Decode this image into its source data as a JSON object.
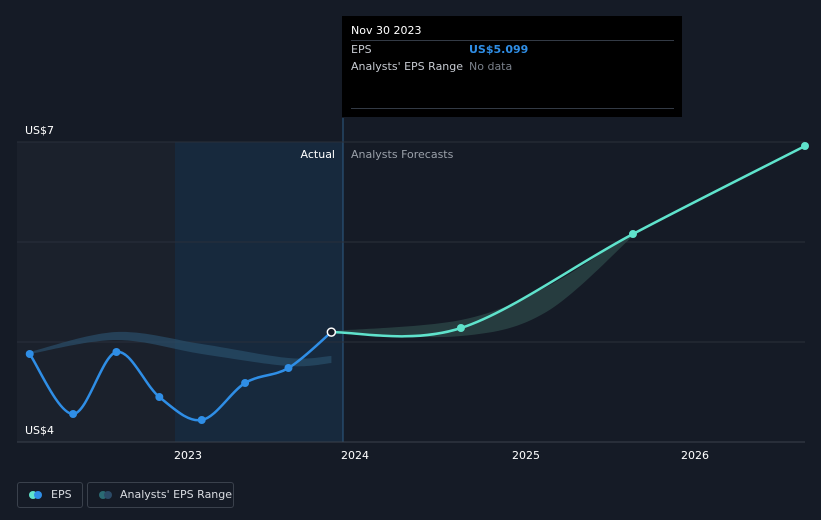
{
  "tooltip": {
    "date": "Nov 30 2023",
    "eps_label": "EPS",
    "eps_value": "US$5.099",
    "range_label": "Analysts' EPS Range",
    "range_value": "No data"
  },
  "labels": {
    "actual": "Actual",
    "forecast": "Analysts Forecasts"
  },
  "legend": {
    "eps": "EPS",
    "range": "Analysts' EPS Range"
  },
  "colors": {
    "eps_actual": "#2f8ee6",
    "eps_forecast": "#5fe3cc",
    "range_band": "#2a4f6a",
    "background": "#151b26"
  },
  "chart_data": {
    "type": "line",
    "ylim": [
      4,
      7
    ],
    "y_tick_labels": [
      "US$7",
      "US$4"
    ],
    "x_ticks": [
      "2023",
      "2024",
      "2025",
      "2026"
    ],
    "x_range": [
      "2022-02-01",
      "2026-08-31"
    ],
    "series": [
      {
        "name": "EPS",
        "values": [
          {
            "x": "2022-02-28",
            "y": 4.88
          },
          {
            "x": "2022-05-31",
            "y": 4.28
          },
          {
            "x": "2022-08-31",
            "y": 4.9
          },
          {
            "x": "2022-11-30",
            "y": 4.45
          },
          {
            "x": "2023-02-28",
            "y": 4.22
          },
          {
            "x": "2023-05-31",
            "y": 4.59
          },
          {
            "x": "2023-08-31",
            "y": 4.74
          },
          {
            "x": "2023-11-30",
            "y": 5.099
          }
        ]
      },
      {
        "name": "EPS Forecast",
        "values": [
          {
            "x": "2023-11-30",
            "y": 5.099
          },
          {
            "x": "2024-08-31",
            "y": 5.14
          },
          {
            "x": "2025-08-31",
            "y": 6.08
          },
          {
            "x": "2026-08-31",
            "y": 6.96
          }
        ]
      },
      {
        "name": "Analysts' EPS Range (historical band)",
        "upper": [
          {
            "x": "2022-02-28",
            "y": 4.9
          },
          {
            "x": "2022-08-31",
            "y": 5.1
          },
          {
            "x": "2023-02-28",
            "y": 4.98
          },
          {
            "x": "2023-08-31",
            "y": 4.84
          },
          {
            "x": "2023-11-30",
            "y": 4.86
          }
        ],
        "lower": [
          {
            "x": "2022-02-28",
            "y": 4.88
          },
          {
            "x": "2022-08-31",
            "y": 5.02
          },
          {
            "x": "2023-02-28",
            "y": 4.88
          },
          {
            "x": "2023-08-31",
            "y": 4.76
          },
          {
            "x": "2023-11-30",
            "y": 4.79
          }
        ]
      },
      {
        "name": "Analysts' EPS Range (forecast band)",
        "upper": [
          {
            "x": "2023-11-30",
            "y": 5.11
          },
          {
            "x": "2024-08-31",
            "y": 5.22
          },
          {
            "x": "2025-02-28",
            "y": 5.55
          },
          {
            "x": "2025-08-31",
            "y": 6.1
          }
        ],
        "lower": [
          {
            "x": "2023-11-30",
            "y": 5.09
          },
          {
            "x": "2024-08-31",
            "y": 5.06
          },
          {
            "x": "2025-02-28",
            "y": 5.3
          },
          {
            "x": "2025-08-31",
            "y": 6.06
          }
        ]
      }
    ]
  }
}
